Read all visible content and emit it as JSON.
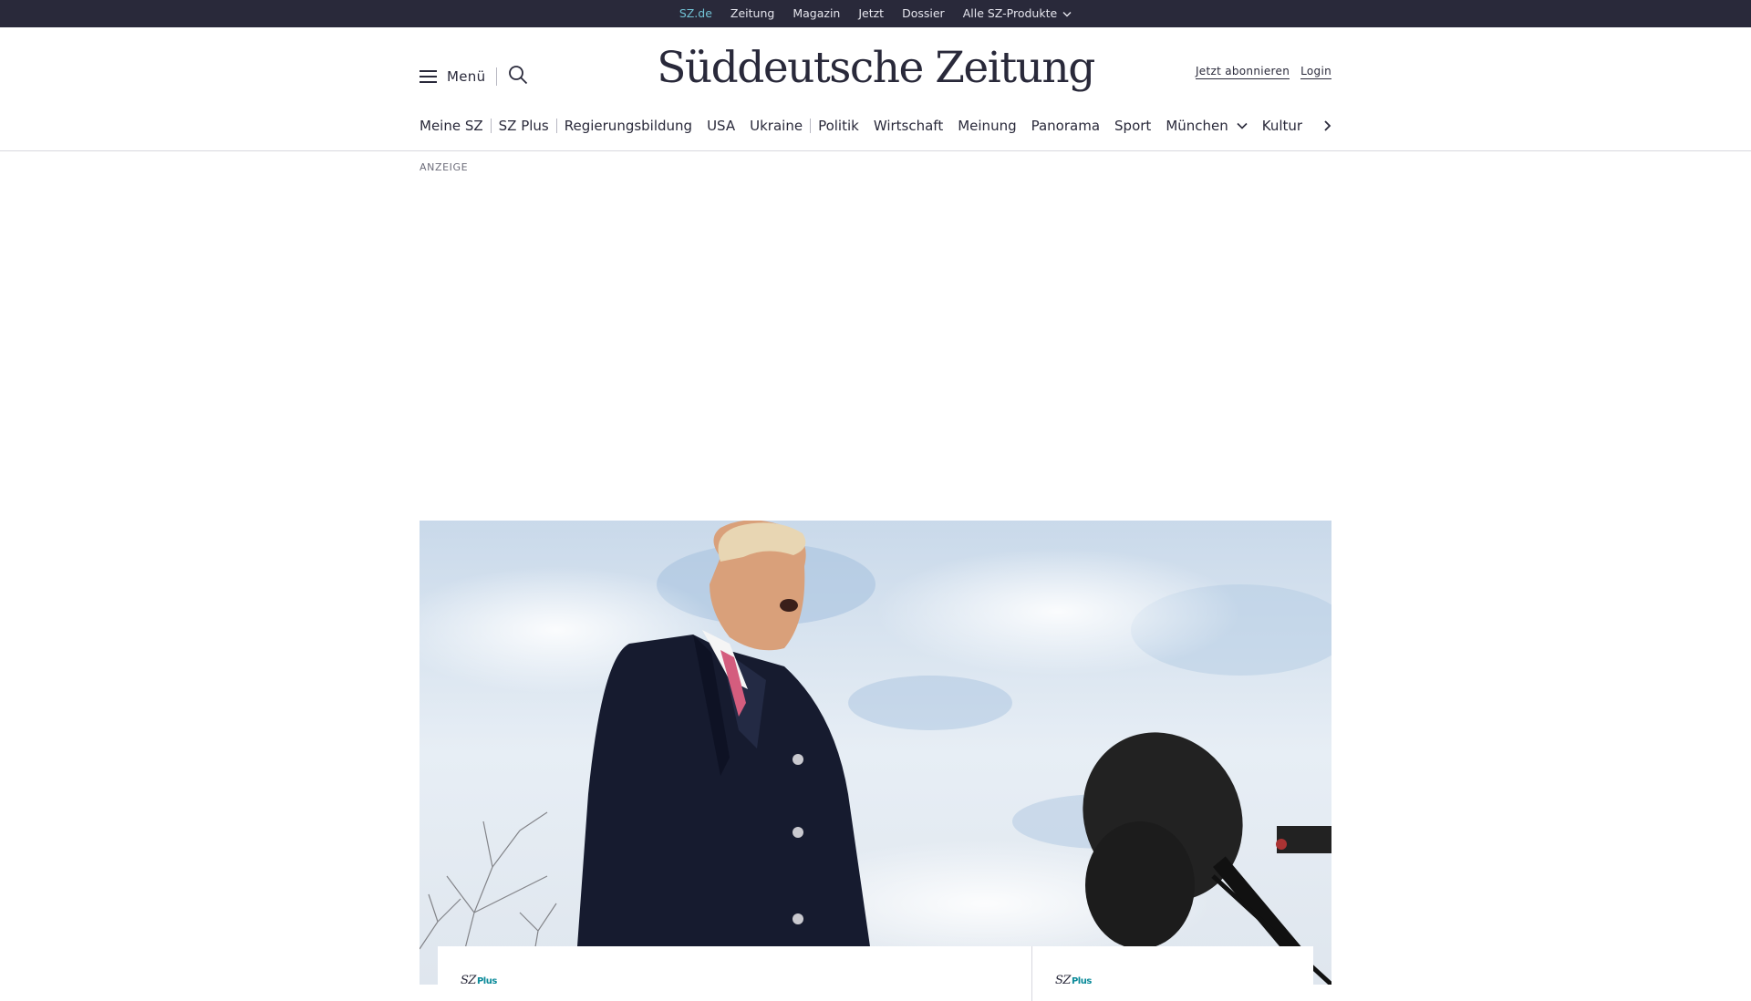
{
  "topbar": {
    "products": [
      "SZ.de",
      "Zeitung",
      "Magazin",
      "Jetzt",
      "Dossier"
    ],
    "all_products_label": "Alle SZ-Produkte"
  },
  "header": {
    "menu_label": "Menü",
    "logo_text": "Süddeutsche Zeitung",
    "subscribe_label": "Jetzt abonnieren",
    "login_label": "Login"
  },
  "nav": {
    "items": [
      "Meine SZ",
      "SZ Plus",
      "Regierungsbildung",
      "USA",
      "Ukraine",
      "Politik",
      "Wirtschaft",
      "Meinung",
      "Panorama",
      "Sport",
      "München",
      "Kultur"
    ]
  },
  "ad": {
    "label": "ANZEIGE"
  },
  "teasers": [
    {
      "brand": "SZ",
      "badge": "Plus"
    },
    {
      "brand": "SZ",
      "badge": "Plus"
    }
  ],
  "colors": {
    "topbar_bg": "#29293a",
    "active_product": "#71c1d4",
    "plus_accent": "#0a8a99",
    "text": "#29293a"
  },
  "icons": {
    "menu": "hamburger-icon",
    "search": "magnifier-icon",
    "dropdown": "chevron-down-icon",
    "nav_more": "chevron-right-icon"
  }
}
